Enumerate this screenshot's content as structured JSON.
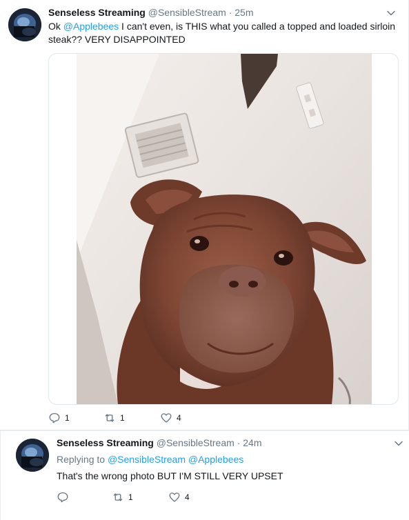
{
  "tweet_main": {
    "author_name": "Senseless Streaming",
    "author_handle": "@SensibleStream",
    "separator": "·",
    "time": "25m",
    "text_before": "Ok ",
    "mention": "@Applebees",
    "text_after": " I can't even, is THIS what you called a topped and loaded sirloin steak?? VERY DISAPPOINTED",
    "reply_count": "1",
    "retweet_count": "1",
    "like_count": "4"
  },
  "tweet_reply": {
    "author_name": "Senseless Streaming",
    "author_handle": "@SensibleStream",
    "separator": "·",
    "time": "24m",
    "replying_label": "Replying to",
    "replying_mention_1": "@SensibleStream",
    "replying_mention_2": "@Applebees",
    "text": "That's the wrong photo BUT I'M STILL VERY UPSET",
    "reply_count": "",
    "retweet_count": "1",
    "like_count": "4"
  },
  "icons": {
    "reply": "reply-icon",
    "retweet": "retweet-icon",
    "like": "heart-icon",
    "caret": "chevron-down-icon"
  },
  "colors": {
    "link": "#1da1f2",
    "secondary_text": "#657786",
    "primary_text": "#14171a"
  }
}
